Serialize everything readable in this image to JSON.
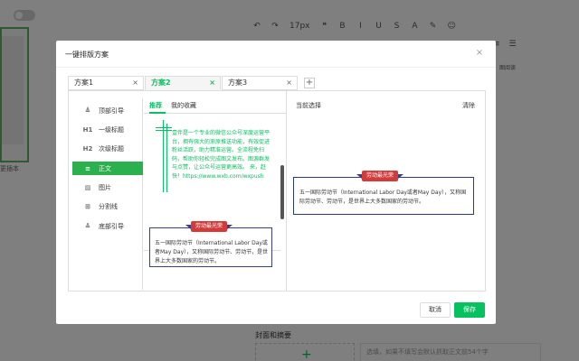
{
  "background": {
    "toolbar_items": [
      "↶",
      "↷",
      "17px",
      "❝",
      "B",
      "I",
      "U",
      "S",
      "A",
      "✎",
      "☺"
    ],
    "left_text": "更插本",
    "right_read": "图阅读",
    "cover_title": "封面和摘要",
    "summary_placeholder": "选填，如果不填写会默认抓取正文前54个字"
  },
  "dialog": {
    "title": "一键排版方案",
    "close": "×",
    "tabs": [
      {
        "label": "方案1",
        "close": "×"
      },
      {
        "label": "方案2",
        "close": "×"
      },
      {
        "label": "方案3",
        "close": "×"
      }
    ],
    "add_tab": "+",
    "categories": [
      {
        "icon": "≜",
        "label": "顶部引导"
      },
      {
        "icon": "H1",
        "label": "一级标题"
      },
      {
        "icon": "H2",
        "label": "次级标题"
      },
      {
        "icon": "≡",
        "label": "正文"
      },
      {
        "icon": "▨",
        "label": "图片"
      },
      {
        "icon": "⊞",
        "label": "分割线"
      },
      {
        "icon": "≚",
        "label": "底部引导"
      }
    ],
    "active_category": "正文",
    "template_tabs": [
      "推荐",
      "我的收藏"
    ],
    "template1_text": "壹伴是一个专业的微信公众号深度运营平台，拥有强大的渐原推送功能，有效促进粉丝活跃，助力精准运营。全流程免扫码，帮助你轻松完成图文发布。图源群发与点赞，让公众号运营更高效。 来，赶快！https://www.wxb.com/wxpush",
    "template2_ribbon": "劳动最光荣",
    "template2_text": "五一国际劳动节（International Labor Day或者May Day），又称国际劳动节、劳动节，是世界上大多数国家的劳动节。",
    "right_title": "当前选择",
    "right_clear": "清除",
    "preview_ribbon": "劳动最光荣",
    "preview_text": "五一国际劳动节（International Labor Day或者May Day），又称国际劳动节、劳动节，是世界上大多数国家的劳动节。",
    "cancel": "取消",
    "save": "保存"
  }
}
